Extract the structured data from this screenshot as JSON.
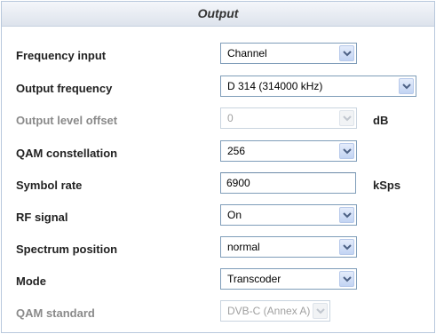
{
  "panel": {
    "title": "Output"
  },
  "fields": {
    "frequency_input": {
      "label": "Frequency input",
      "value": "Channel"
    },
    "output_frequency": {
      "label": "Output frequency",
      "value": "D 314 (314000 kHz)"
    },
    "output_level_offset": {
      "label": "Output level offset",
      "value": "0",
      "unit": "dB"
    },
    "qam_constellation": {
      "label": "QAM constellation",
      "value": "256"
    },
    "symbol_rate": {
      "label": "Symbol rate",
      "value": "6900",
      "unit": "kSps"
    },
    "rf_signal": {
      "label": "RF signal",
      "value": "On"
    },
    "spectrum_position": {
      "label": "Spectrum position",
      "value": "normal"
    },
    "mode": {
      "label": "Mode",
      "value": "Transcoder"
    },
    "qam_standard": {
      "label": "QAM standard",
      "value": "DVB-C (Annex A)"
    }
  },
  "icons": {
    "dropdown": "chevron-down-icon"
  },
  "colors": {
    "border": "#7f9db9",
    "disabled_text": "#a0a0a0",
    "arrow": "#4d6185"
  }
}
